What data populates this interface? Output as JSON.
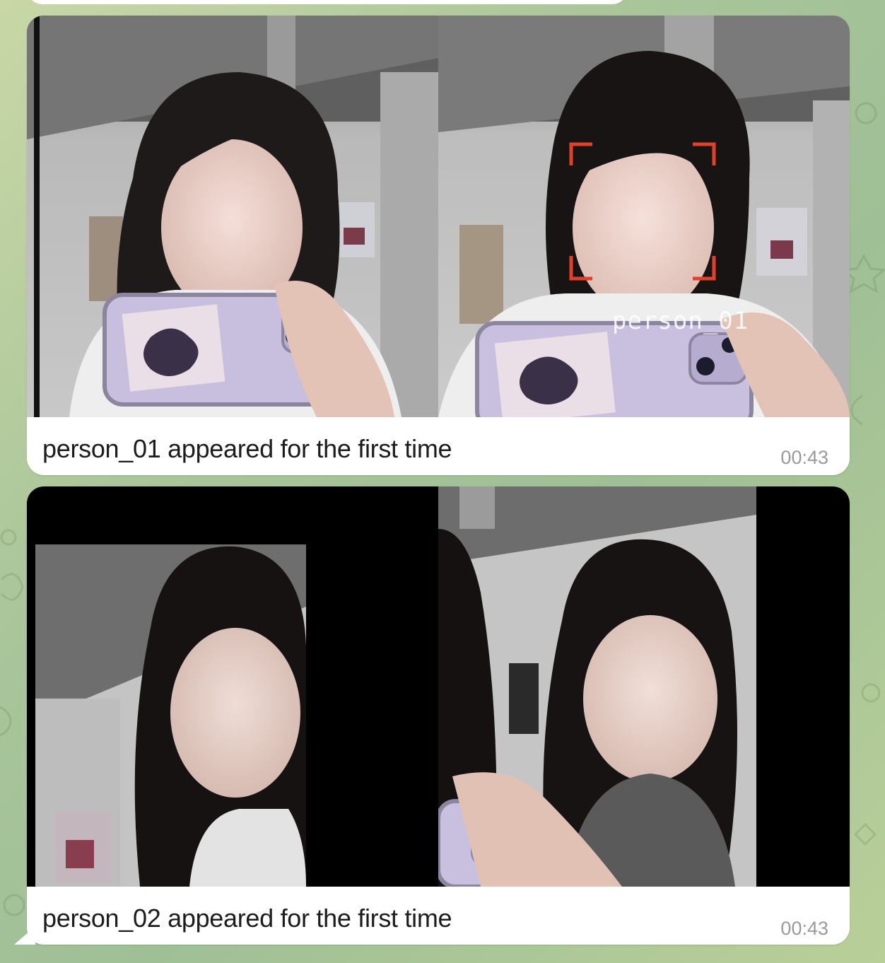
{
  "messages": [
    {
      "caption": "person_01 appeared for the first time",
      "time": "00:43",
      "detection_label": "person_01"
    },
    {
      "caption": "person_02 appeared for the first time",
      "time": "00:43"
    }
  ],
  "colors": {
    "chat_background": "#a9c59a",
    "bubble": "#ffffff",
    "detection_box": "#e2402a",
    "timestamp": "#9a9a9a"
  }
}
